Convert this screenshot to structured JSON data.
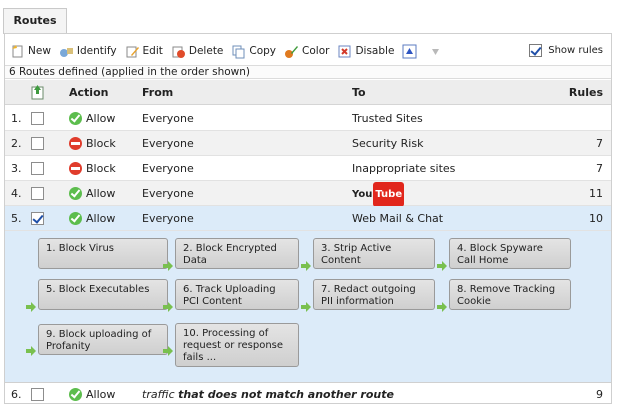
{
  "tab": {
    "label": "Routes"
  },
  "toolbar": {
    "buttons": [
      {
        "label": "New",
        "icon": "new-icon"
      },
      {
        "label": "Identify",
        "icon": "identify-icon"
      },
      {
        "label": "Edit",
        "icon": "edit-icon"
      },
      {
        "label": "Delete",
        "icon": "delete-icon"
      },
      {
        "label": "Copy",
        "icon": "copy-icon"
      },
      {
        "label": "Color",
        "icon": "color-icon"
      },
      {
        "label": "Disable",
        "icon": "disable-icon"
      }
    ],
    "show_rules_label": "Show rules",
    "show_rules_checked": true
  },
  "summary": "6 Routes defined (applied in the order shown)",
  "table": {
    "columns": {
      "action": "Action",
      "from": "From",
      "to": "To",
      "rules": "Rules"
    },
    "rows": [
      {
        "num": "1.",
        "checked": false,
        "action": "Allow",
        "action_type": "allow",
        "from": "Everyone",
        "to": "Trusted Sites",
        "rules": ""
      },
      {
        "num": "2.",
        "checked": false,
        "action": "Block",
        "action_type": "block",
        "from": "Everyone",
        "to": "Security Risk",
        "rules": "7"
      },
      {
        "num": "3.",
        "checked": false,
        "action": "Block",
        "action_type": "block",
        "from": "Everyone",
        "to": "Inappropriate sites",
        "rules": "7"
      },
      {
        "num": "4.",
        "checked": false,
        "action": "Allow",
        "action_type": "allow",
        "from": "Everyone",
        "to_logo": {
          "you": "You",
          "tube": "Tube"
        },
        "rules": "11"
      },
      {
        "num": "5.",
        "checked": true,
        "action": "Allow",
        "action_type": "allow",
        "from": "Everyone",
        "to": "Web Mail & Chat",
        "rules": "10"
      }
    ],
    "rules": [
      "1. Block Virus",
      "2. Block Encrypted Data",
      "3. Strip Active Content",
      "4. Block Spyware Call Home",
      "5. Block Executables",
      "6. Track Uploading PCI Content",
      "7. Redact outgoing PII information",
      "8. Remove Tracking Cookie",
      "9. Block uploading of Profanity",
      "10. Processing of request or response fails ..."
    ],
    "default_row": {
      "num": "6.",
      "checked": false,
      "action": "Allow",
      "text_italic": "traffic",
      "text_bold_italic": "that does not match another route",
      "rules": "9"
    }
  },
  "colors": {
    "allow": "#5cbd4d",
    "block": "#e03c2c",
    "selected_row": "#dcebf9",
    "arrow": "#79c04f"
  }
}
